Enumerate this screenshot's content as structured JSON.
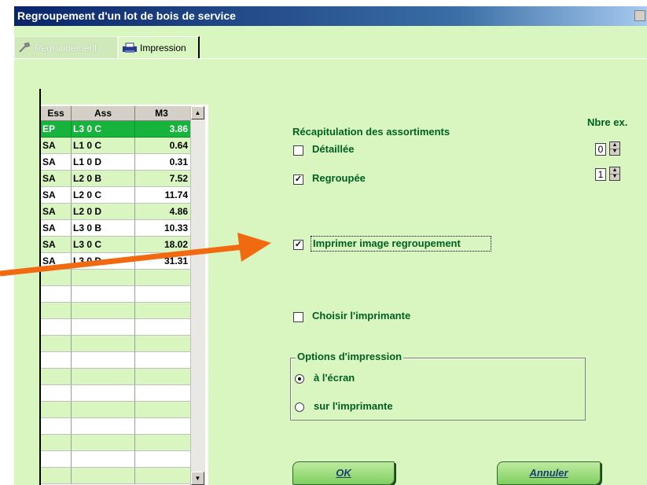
{
  "window": {
    "title": "Regroupement d'un lot de bois de service"
  },
  "tabs": [
    {
      "label": "Regroupement",
      "icon": "wrench-icon"
    },
    {
      "label": "Impression",
      "icon": "printer-icon"
    }
  ],
  "grid": {
    "headers": [
      "Ess",
      "Ass",
      "M3"
    ],
    "rows": [
      [
        "EP",
        "L3 0 C",
        "3.86"
      ],
      [
        "SA",
        "L1 0 C",
        "0.64"
      ],
      [
        "SA",
        "L1 0 D",
        "0.31"
      ],
      [
        "SA",
        "L2 0 B",
        "7.52"
      ],
      [
        "SA",
        "L2 0 C",
        "11.74"
      ],
      [
        "SA",
        "L2 0 D",
        "4.86"
      ],
      [
        "SA",
        "L3 0 B",
        "10.33"
      ],
      [
        "SA",
        "L3 0 C",
        "18.02"
      ],
      [
        "SA",
        "L3 0 D",
        "31.31"
      ]
    ]
  },
  "recap": {
    "heading": "Récapitulation des assortiments",
    "copies_label": "Nbre ex.",
    "detaillee": {
      "label": "Détaillée",
      "checked": false,
      "copies": "0"
    },
    "regroupee": {
      "label": "Regroupée",
      "checked": true,
      "copies": "1"
    }
  },
  "print_image": {
    "label": "Imprimer image regroupement",
    "checked": true
  },
  "choose_printer": {
    "label": "Choisir l'imprimante",
    "checked": false
  },
  "print_options": {
    "title": "Options d'impression",
    "options": [
      {
        "label": "à l'écran",
        "selected": true
      },
      {
        "label": "sur l'imprimante",
        "selected": false
      }
    ]
  },
  "buttons": {
    "ok": "OK",
    "cancel": "Annuler"
  },
  "colors": {
    "accent_green": "#16b43c",
    "panel": "#d9f5c0",
    "arrow": "#f26a10"
  }
}
